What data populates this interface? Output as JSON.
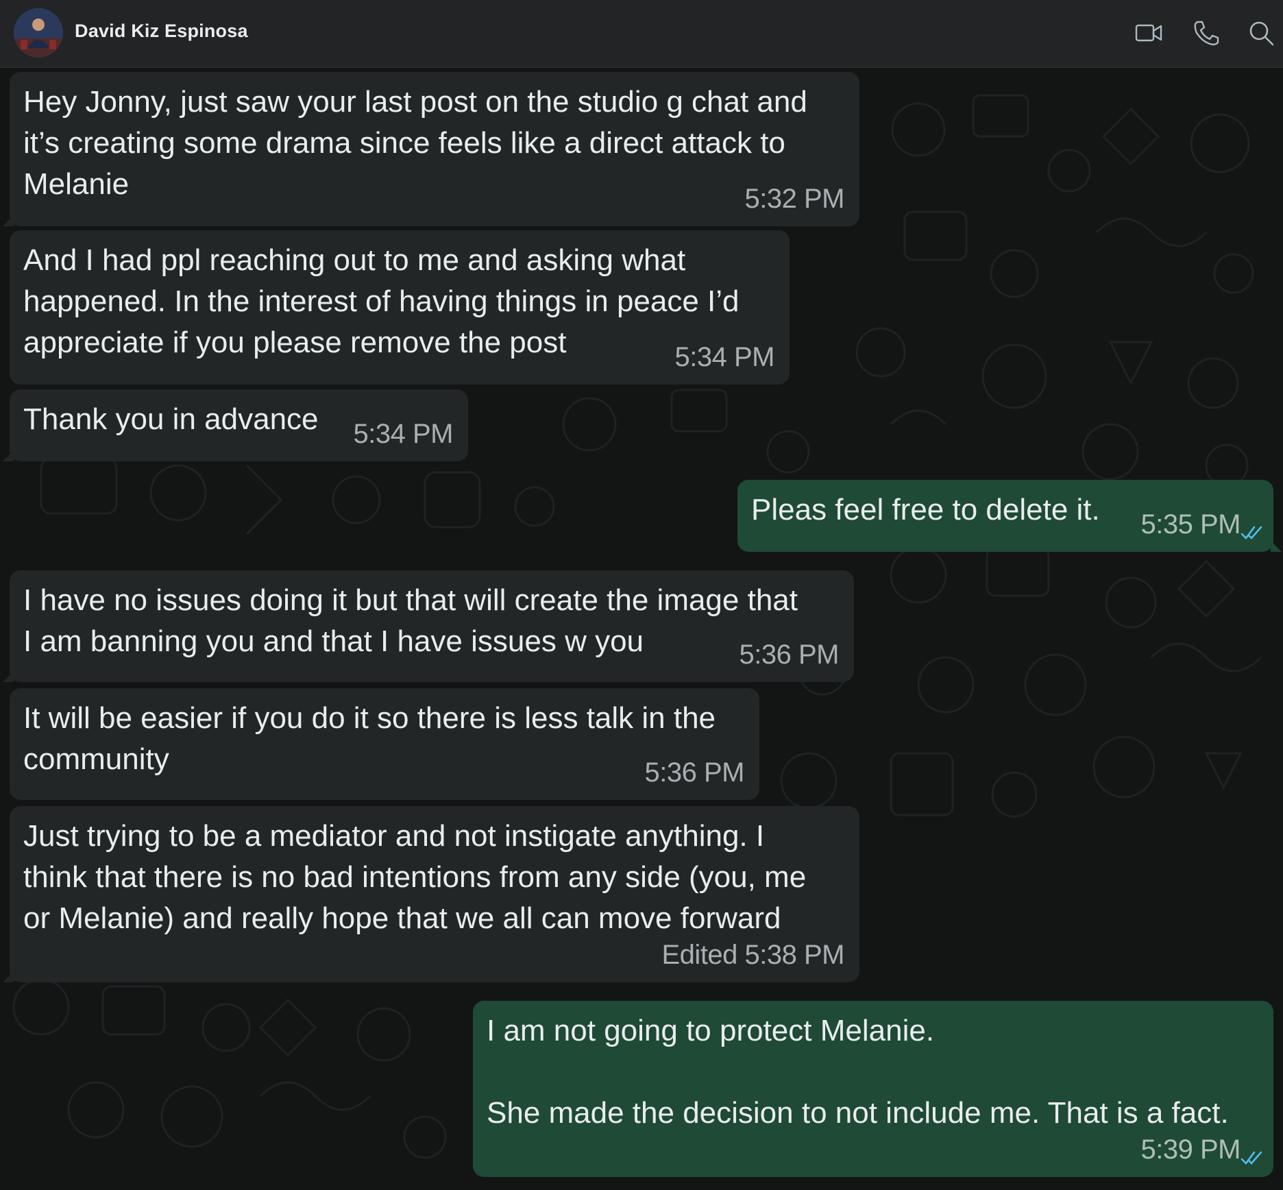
{
  "header": {
    "contact_name": "David Kiz Espinosa",
    "icons": [
      "video-call-icon",
      "voice-call-icon",
      "search-icon"
    ]
  },
  "colors": {
    "header_bg": "#222425",
    "chat_bg": "#131515",
    "incoming_bubble": "#232626",
    "outgoing_bubble": "#1f4a35",
    "read_ticks": "#53bdeb"
  },
  "messages": [
    {
      "direction": "incoming",
      "text": "Hey Jonny, just saw your last post on the studio g chat and\nit’s creating some drama since feels like a direct attack to\nMelanie",
      "time": "5:32 PM"
    },
    {
      "direction": "incoming",
      "text": "And I had ppl reaching out to me and asking what\nhappened. In the interest of having things in peace I’d\nappreciate if you please remove the post",
      "time": "5:34 PM"
    },
    {
      "direction": "incoming",
      "text": "Thank you in advance",
      "time": "5:34 PM"
    },
    {
      "direction": "outgoing",
      "text": "Pleas feel free to delete it.",
      "time": "5:35 PM",
      "status": "read"
    },
    {
      "direction": "incoming",
      "text": "I have no issues doing it but that will create the image that\nI am banning you and that I have issues w you",
      "time": "5:36 PM"
    },
    {
      "direction": "incoming",
      "text": "It will be easier if you do it so there is less talk in the\ncommunity",
      "time": "5:36 PM"
    },
    {
      "direction": "incoming",
      "text": "Just trying to be a mediator and not instigate anything. I\nthink that there is no bad intentions from any side (you, me\nor Melanie) and really hope that we all can move forward",
      "time": "Edited 5:38 PM"
    },
    {
      "direction": "outgoing",
      "text": "I am not going to protect Melanie.\n\nShe made the decision to not include me. That is a fact.",
      "time": "5:39 PM",
      "status": "read"
    }
  ]
}
